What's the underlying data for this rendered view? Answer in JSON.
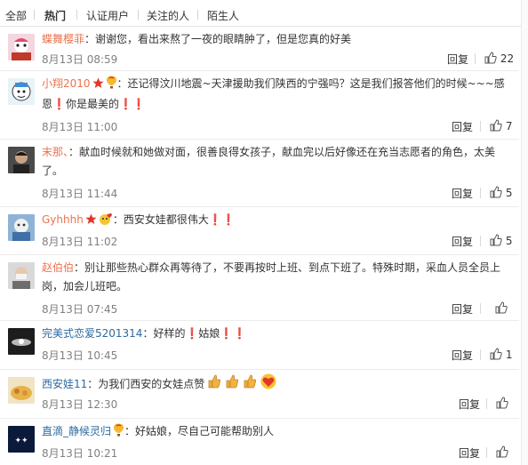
{
  "tabs": {
    "all": "全部",
    "hot": "热门",
    "verified": "认证用户",
    "following": "关注的人",
    "strangers": "陌生人"
  },
  "reply_label": "回复",
  "comments": [
    {
      "user": "蝶舞樱菲",
      "text": "：谢谢您，看出来熬了一夜的眼睛肿了，但是您真的好美",
      "time": "8月13日 08:59",
      "likes": "22"
    },
    {
      "user": "小翔2010",
      "text": "：还记得汶川地震~天津援助我们陕西的宁强吗？这是我们报答他们的时候~~~感恩❗你是最美的❗❗",
      "time": "8月13日 11:00",
      "likes": "7"
    },
    {
      "user": "末那、",
      "text": "：献血时候就和她做对面，很善良得女孩子，献血完以后好像还在充当志愿者的角色，太美了。",
      "time": "8月13日 11:44",
      "likes": "5"
    },
    {
      "user": "Gyhhhh",
      "text": "：西安女娃都很伟大❗❗",
      "time": "8月13日 11:02",
      "likes": "5"
    },
    {
      "user": "赵伯伯",
      "text": "：别让那些热心群众再等待了，不要再按时上班、到点下班了。特殊时期，采血人员全员上岗，加会儿班吧。",
      "time": "8月13日 07:45",
      "likes": ""
    },
    {
      "user": "完美式恋爱5201314",
      "text": "：好样的❗姑娘❗❗",
      "time": "8月13日 10:45",
      "likes": "1"
    },
    {
      "user": "西安娃11",
      "text": "：为我们西安的女娃点赞",
      "time": "8月13日 12:30",
      "likes": ""
    },
    {
      "user": "直滴_静候灵归",
      "text": "：好姑娘，尽自己可能帮助别人",
      "time": "8月13日 10:21",
      "likes": ""
    }
  ],
  "icons": {
    "like": "thumbs-up-icon",
    "star": "star-badge-icon",
    "balloon": "hot-air-balloon-icon",
    "thumb_emoji": "thumbs-up-emoji-icon",
    "heart_emoji": "heart-emoji-icon"
  },
  "colors": {
    "username": "#eb7350",
    "username_alt": "#2d6aa0",
    "time": "#808080",
    "text": "#333333"
  }
}
